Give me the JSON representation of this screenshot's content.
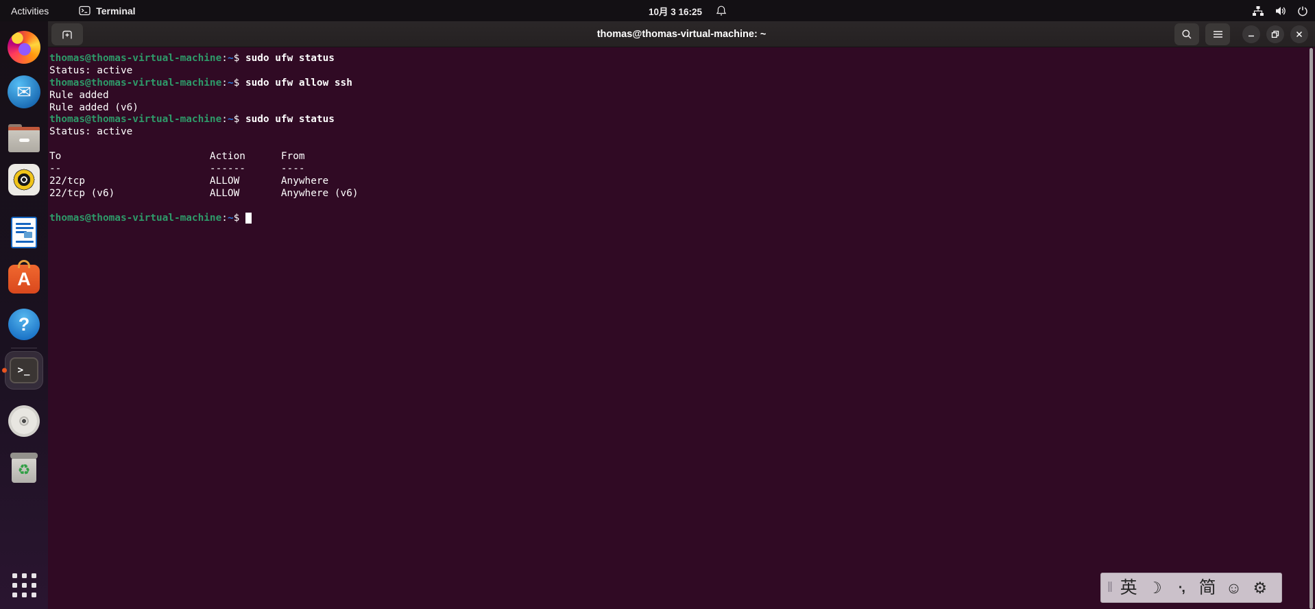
{
  "topbar": {
    "activities_label": "Activities",
    "focused_app": "Terminal",
    "clock": "10月 3  16:25"
  },
  "window": {
    "title": "thomas@thomas-virtual-machine: ~"
  },
  "dock": {
    "running_app": "terminal",
    "items": [
      {
        "name": "firefox"
      },
      {
        "name": "thunderbird",
        "glyph": "✉"
      },
      {
        "name": "files"
      },
      {
        "name": "rhythmbox"
      },
      {
        "name": "libreoffice-writer"
      },
      {
        "name": "ubuntu-software",
        "glyph": "A"
      },
      {
        "name": "help",
        "glyph": "?"
      },
      {
        "name": "terminal",
        "glyph": ">_",
        "running": true,
        "active": true
      },
      {
        "name": "cd-disc"
      },
      {
        "name": "trash",
        "glyph": "♻"
      },
      {
        "name": "show-applications"
      }
    ]
  },
  "terminal": {
    "colors": {
      "background": "#300a24",
      "prompt_green": "#2e9a69",
      "path_blue": "#2a7bde",
      "text": "#ffffff"
    },
    "lines": [
      [
        {
          "c": "p",
          "t": "thomas@thomas-virtual-machine"
        },
        {
          "c": "w",
          "t": ":"
        },
        {
          "c": "b",
          "t": "~"
        },
        {
          "c": "w",
          "t": "$ "
        },
        {
          "c": "c",
          "t": "sudo ufw status"
        }
      ],
      [
        {
          "c": "w",
          "t": "Status: active"
        }
      ],
      [
        {
          "c": "p",
          "t": "thomas@thomas-virtual-machine"
        },
        {
          "c": "w",
          "t": ":"
        },
        {
          "c": "b",
          "t": "~"
        },
        {
          "c": "w",
          "t": "$ "
        },
        {
          "c": "c",
          "t": "sudo ufw allow ssh"
        }
      ],
      [
        {
          "c": "w",
          "t": "Rule added"
        }
      ],
      [
        {
          "c": "w",
          "t": "Rule added (v6)"
        }
      ],
      [
        {
          "c": "p",
          "t": "thomas@thomas-virtual-machine"
        },
        {
          "c": "w",
          "t": ":"
        },
        {
          "c": "b",
          "t": "~"
        },
        {
          "c": "w",
          "t": "$ "
        },
        {
          "c": "c",
          "t": "sudo ufw status"
        }
      ],
      [
        {
          "c": "w",
          "t": "Status: active"
        }
      ],
      [],
      [
        {
          "c": "w",
          "t": "To                         Action      From"
        }
      ],
      [
        {
          "c": "w",
          "t": "--                         ------      ----"
        }
      ],
      [
        {
          "c": "w",
          "t": "22/tcp                     ALLOW       Anywhere"
        }
      ],
      [
        {
          "c": "w",
          "t": "22/tcp (v6)                ALLOW       Anywhere (v6)"
        }
      ],
      [],
      [
        {
          "c": "p",
          "t": "thomas@thomas-virtual-machine"
        },
        {
          "c": "w",
          "t": ":"
        },
        {
          "c": "b",
          "t": "~"
        },
        {
          "c": "w",
          "t": "$ "
        },
        {
          "c": "cur",
          "t": " "
        }
      ]
    ]
  },
  "im_panel": {
    "items": [
      {
        "name": "drag-handle",
        "glyph": "‖"
      },
      {
        "name": "lang-mode-english",
        "glyph": "英"
      },
      {
        "name": "fullwidth-moon",
        "glyph": "☽"
      },
      {
        "name": "punctuation-mode",
        "glyph": "·,"
      },
      {
        "name": "simplified-chinese",
        "glyph": "简"
      },
      {
        "name": "emoji-picker",
        "glyph": "☺"
      },
      {
        "name": "ime-settings",
        "glyph": "⚙"
      }
    ]
  }
}
